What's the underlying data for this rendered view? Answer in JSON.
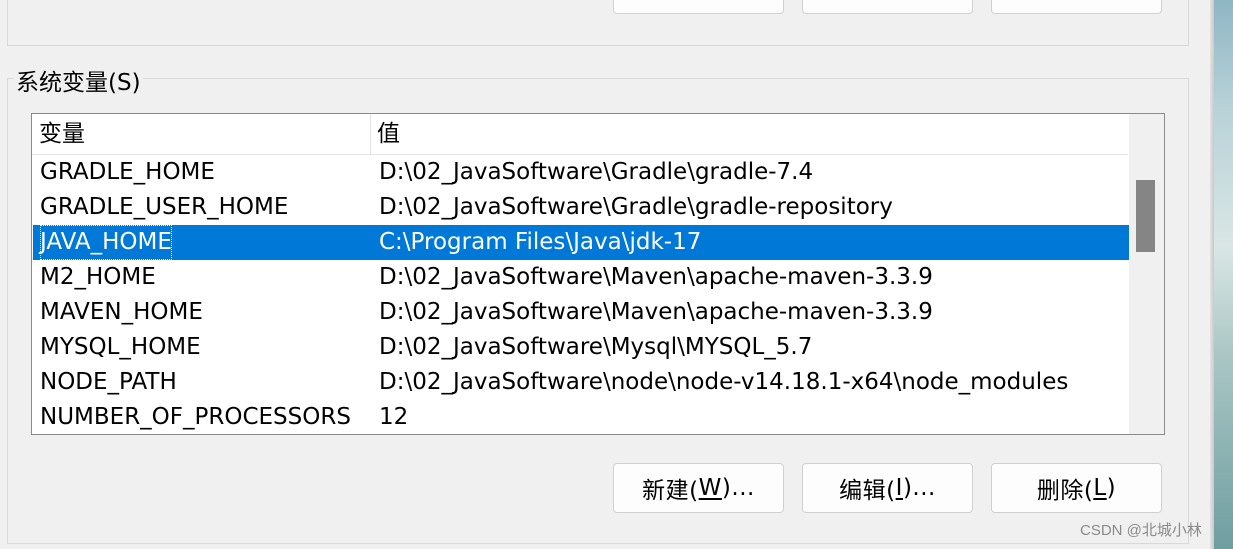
{
  "group": {
    "title": "系统变量(S)"
  },
  "table": {
    "columns": [
      "变量",
      "值"
    ],
    "rows": [
      {
        "name": "GRADLE_HOME",
        "value": "D:\\02_JavaSoftware\\Gradle\\gradle-7.4",
        "selected": false
      },
      {
        "name": "GRADLE_USER_HOME",
        "value": "D:\\02_JavaSoftware\\Gradle\\gradle-repository",
        "selected": false
      },
      {
        "name": "JAVA_HOME",
        "value": "C:\\Program Files\\Java\\jdk-17",
        "selected": true
      },
      {
        "name": "M2_HOME",
        "value": "D:\\02_JavaSoftware\\Maven\\apache-maven-3.3.9",
        "selected": false
      },
      {
        "name": "MAVEN_HOME",
        "value": "D:\\02_JavaSoftware\\Maven\\apache-maven-3.3.9",
        "selected": false
      },
      {
        "name": "MYSQL_HOME",
        "value": "D:\\02_JavaSoftware\\Mysql\\MYSQL_5.7",
        "selected": false
      },
      {
        "name": "NODE_PATH",
        "value": "D:\\02_JavaSoftware\\node\\node-v14.18.1-x64\\node_modules",
        "selected": false
      },
      {
        "name": "NUMBER_OF_PROCESSORS",
        "value": "12",
        "selected": false
      }
    ]
  },
  "buttons": {
    "new_prefix": "新建(",
    "new_key": "W",
    "new_suffix": ")...",
    "edit_prefix": "编辑(",
    "edit_key": "I",
    "edit_suffix": ")...",
    "delete_prefix": "删除(",
    "delete_key": "L",
    "delete_suffix": ")"
  },
  "watermark": "CSDN @北城小林",
  "colors": {
    "selection": "#0078d7",
    "background": "#f0f0f0"
  }
}
